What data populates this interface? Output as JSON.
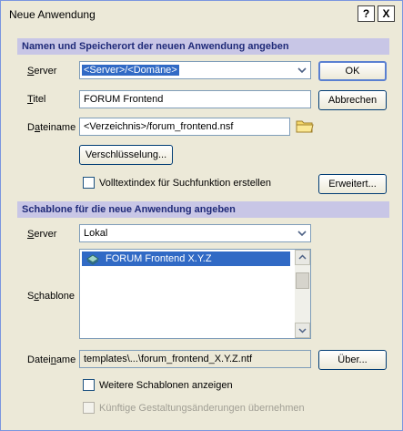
{
  "window": {
    "title": "Neue Anwendung",
    "help_btn": "?",
    "close_btn": "X"
  },
  "section1": {
    "title": "Namen und Speicherort der neuen Anwendung angeben"
  },
  "server1": {
    "label": "Server",
    "value": "<Server>/<Domäne>"
  },
  "titel": {
    "label": "Titel",
    "value": "FORUM Frontend"
  },
  "dateiname1": {
    "label": "Dateiname",
    "value": "<Verzeichnis>/forum_frontend.nsf"
  },
  "buttons": {
    "ok": "OK",
    "abbrechen": "Abbrechen",
    "verschluesselung": "Verschlüsselung...",
    "erweitert": "Erweitert...",
    "ueber": "Über..."
  },
  "volltext": {
    "label": "Volltextindex für Suchfunktion erstellen"
  },
  "section2": {
    "title": "Schablone für die neue Anwendung angeben"
  },
  "server2": {
    "label": "Server",
    "value": "Lokal"
  },
  "schablone": {
    "label": "Schablone",
    "items": [
      "FORUM Frontend X.Y.Z"
    ]
  },
  "dateiname2": {
    "label": "Dateiname",
    "value": "templates\\...\\forum_frontend_X.Y.Z.ntf"
  },
  "weitere": {
    "label": "Weitere Schablonen anzeigen"
  },
  "kuenftige": {
    "label": "Künftige Gestaltungsänderungen übernehmen"
  }
}
